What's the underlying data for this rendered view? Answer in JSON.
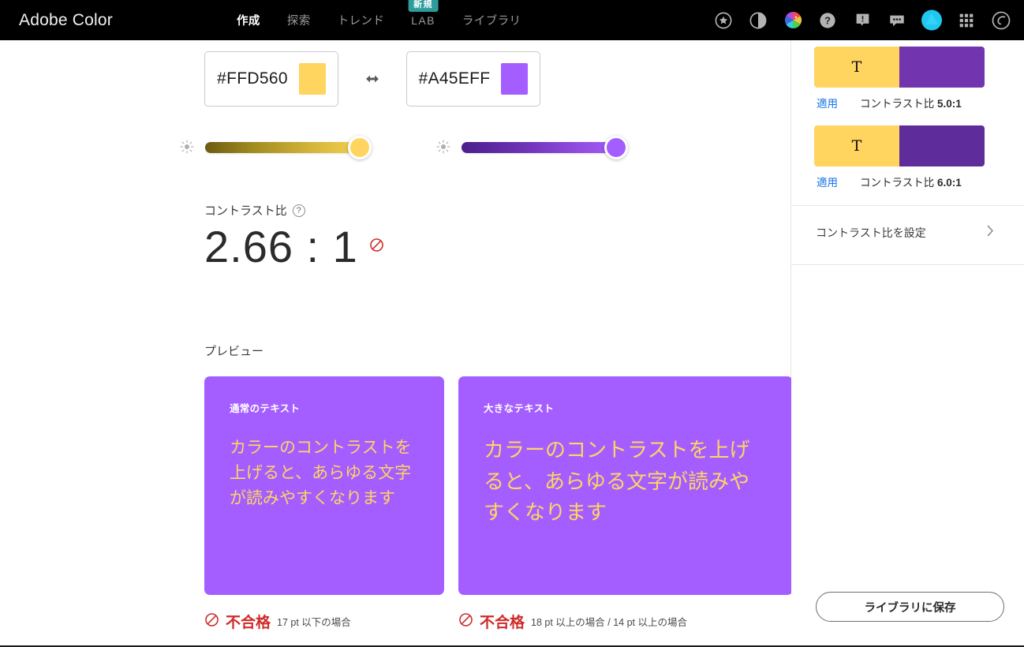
{
  "header": {
    "brand": "Adobe Color",
    "tabs": [
      {
        "label": "作成",
        "active": true
      },
      {
        "label": "探索",
        "active": false
      },
      {
        "label": "トレンド",
        "active": false
      },
      {
        "label": "LAB",
        "active": false,
        "badge": "新規"
      },
      {
        "label": "ライブラリ",
        "active": false
      }
    ],
    "icons": [
      "star-icon",
      "contrast-icon",
      "color-wheel-icon",
      "help-icon",
      "notification-icon",
      "chat-icon",
      "profile-avatar",
      "app-grid-icon",
      "creative-cloud-icon"
    ],
    "badge_color": "#2c9c9c",
    "background": "#000000"
  },
  "colors": {
    "foreground_hex": "#FFD560",
    "background_hex": "#A45EFF",
    "swap_icon": "swap-horizontal-icon"
  },
  "sliders": {
    "left": {
      "icon": "brightness-icon",
      "value_percent": 100,
      "gradient_start": "#6b5a12",
      "gradient_end": "#ffd560",
      "knob_color": "#ffd560"
    },
    "right": {
      "icon": "brightness-icon",
      "value_percent": 100,
      "gradient_start": "#4b1f8c",
      "gradient_end": "#a45eff",
      "knob_color": "#a45eff"
    }
  },
  "contrast": {
    "label": "コントラスト比",
    "help_icon": "help-circle-icon",
    "value": "2.66 : 1",
    "status_icon": "blocked-icon",
    "status_color": "#cf2b2b"
  },
  "preview": {
    "label": "プレビュー",
    "cards": [
      {
        "kicker": "通常のテキスト",
        "body": "カラーのコントラストを上げると、あらゆる文字が読みやすくなります",
        "bg": "#A45EFF",
        "fg": "#FFD560"
      },
      {
        "kicker": "大きなテキスト",
        "body": "カラーのコントラストを上げると、あらゆる文字が読みやすくなります",
        "bg": "#A45EFF",
        "fg": "#FFD560"
      }
    ],
    "verdicts": [
      {
        "icon": "blocked-icon",
        "text": "不合格",
        "note": "17 pt 以下の場合"
      },
      {
        "icon": "blocked-icon",
        "text": "不合格",
        "note": "18 pt 以上の場合 / 14 pt 以上の場合"
      }
    ]
  },
  "sidebar": {
    "suggestions": [
      {
        "sample_letter": "T",
        "left_color": "#FFD560",
        "right_color": "#7334B0",
        "apply_label": "適用",
        "ratio_label": "コントラスト比",
        "ratio_value": "5.0:1"
      },
      {
        "sample_letter": "T",
        "left_color": "#FFD560",
        "right_color": "#5E2C9B",
        "apply_label": "適用",
        "ratio_label": "コントラスト比",
        "ratio_value": "6.0:1"
      }
    ],
    "set_ratio": {
      "label": "コントラスト比を設定",
      "chevron": "chevron-right-icon"
    },
    "save_button": "ライブラリに保存"
  }
}
